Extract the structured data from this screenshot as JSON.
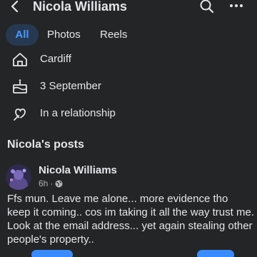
{
  "header": {
    "title": "Nicola Williams",
    "back_icon": "back-chevron-icon",
    "search_icon": "search-icon",
    "more_icon": "more-horizontal-icon"
  },
  "tabs": [
    {
      "label": "All",
      "active": true
    },
    {
      "label": "Photos",
      "active": false
    },
    {
      "label": "Reels",
      "active": false
    }
  ],
  "about": {
    "location": {
      "icon": "home-icon",
      "text": "Cardiff"
    },
    "birthday": {
      "icon": "birthday-cake-icon",
      "text": "3 September"
    },
    "relationship": {
      "icon": "heart-icon",
      "text": "In a relationship"
    }
  },
  "posts_section": {
    "title": "Nicola's posts"
  },
  "post": {
    "author": "Nicola Williams",
    "time": "6h",
    "separator": "·",
    "privacy_icon": "globe-icon",
    "text": "Ffs mun. Leave me alone... more evidence tho keep it coming.. cos im taking it all the way trust me.   Look at the email address... yet again stealing other people's property.."
  },
  "colors": {
    "background": "#242526",
    "text": "#e4e6eb",
    "secondary_text": "#b0b3b8",
    "accent": "#4599ff",
    "active_tab_bg": "#263951"
  }
}
